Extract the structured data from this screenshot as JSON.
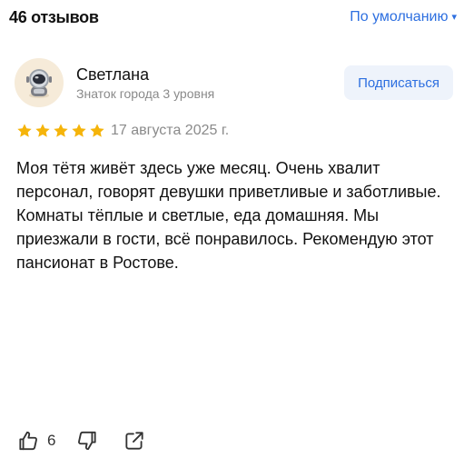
{
  "header": {
    "reviews_count": "46 отзывов",
    "sort_label": "По умолчанию",
    "sort_caret": "▾"
  },
  "review": {
    "author": {
      "name": "Светлана",
      "level": "Знаток города 3 уровня",
      "avatar_icon": "astronaut-avatar-icon"
    },
    "subscribe_label": "Подписаться",
    "rating": 5,
    "date": "17 августа 2025 г.",
    "text": "Моя тётя живёт здесь уже месяц. Очень хвалит персонал, говорят девушки приветливые и заботливые. Комнаты тёплые и светлые, еда домашняя. Мы приезжали в гости, всё понравилось. Рекомендую этот пансионат в Ростове.",
    "likes": "6",
    "icons": {
      "like": "thumbs-up-icon",
      "dislike": "thumbs-down-icon",
      "share": "share-icon"
    }
  },
  "colors": {
    "accent": "#2d6fe0",
    "star": "#f5b40a",
    "muted": "#8a8a8a",
    "button_bg": "#eef3fb"
  }
}
